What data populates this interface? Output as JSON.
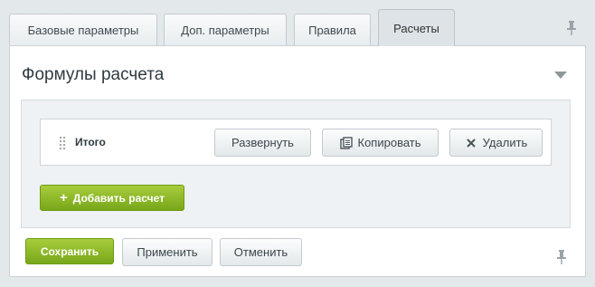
{
  "tabs": [
    {
      "label": "Базовые параметры",
      "active": false
    },
    {
      "label": "Доп. параметры",
      "active": false
    },
    {
      "label": "Правила",
      "active": false
    },
    {
      "label": "Расчеты",
      "active": true
    }
  ],
  "panel": {
    "title": "Формулы расчета",
    "formula_rows": [
      {
        "label": "Итого",
        "buttons": {
          "expand": "Развернуть",
          "copy": "Копировать",
          "delete": "Удалить"
        }
      }
    ],
    "add_button": "Добавить расчет"
  },
  "footer": {
    "save": "Сохранить",
    "apply": "Применить",
    "cancel": "Отменить"
  },
  "icons": {
    "pin": "pin-icon",
    "collapse": "triangle-down-icon",
    "drag": "drag-handle-icon",
    "copy": "copy-icon",
    "delete": "x-icon",
    "add": "plus-icon"
  },
  "colors": {
    "primary_green": "#8dbb2a",
    "background": "#e3e8ea",
    "panel": "#ffffff"
  }
}
